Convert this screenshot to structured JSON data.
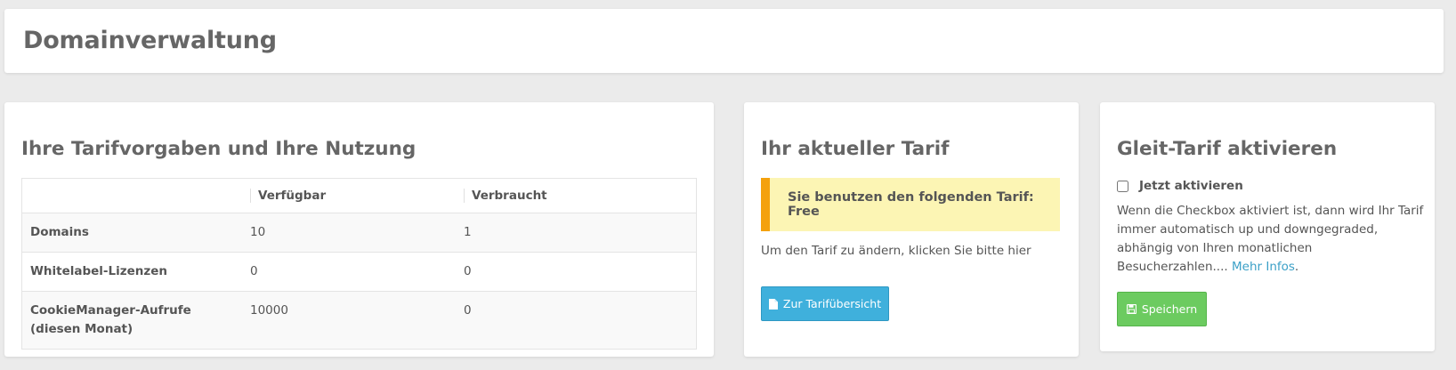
{
  "header": {
    "title": "Domainverwaltung"
  },
  "usage": {
    "title": "Ihre Tarifvorgaben und Ihre Nutzung",
    "columns": [
      "",
      "Verfügbar",
      "Verbraucht"
    ],
    "rows": [
      {
        "label": "Domains",
        "available": "10",
        "used": "1"
      },
      {
        "label": "Whitelabel-Lizenzen",
        "available": "0",
        "used": "0"
      },
      {
        "label": "CookieManager-Aufrufe (diesen Monat)",
        "available": "10000",
        "used": "0"
      }
    ]
  },
  "tariff": {
    "title": "Ihr aktueller Tarif",
    "alert": "Sie benutzen den folgenden Tarif: Free",
    "hint": "Um den Tarif zu ändern, klicken Sie bitte hier",
    "button_label": "Zur Tarifübersicht",
    "button_icon": "file-icon",
    "alert_accent": "#f4a10d",
    "button_color": "#3fb0dc"
  },
  "glide": {
    "title": "Gleit-Tarif aktivieren",
    "checkbox_label": "Jetzt aktivieren",
    "checkbox_checked": false,
    "description": "Wenn die Checkbox aktiviert ist, dann wird Ihr Tarif immer automatisch up und downgegraded, abhängig von Ihren monatlichen Besucherzahlen....",
    "link_text": "Mehr Infos",
    "save_label": "Speichern",
    "save_icon": "save-icon",
    "save_color": "#6ccb60"
  }
}
